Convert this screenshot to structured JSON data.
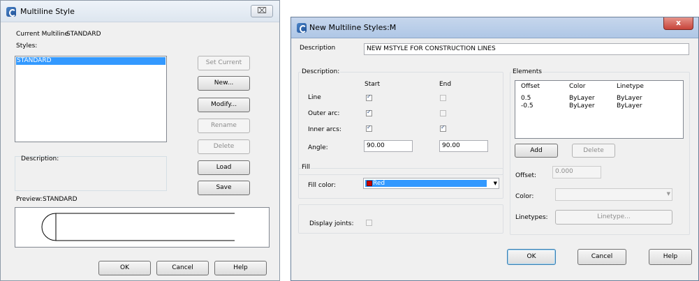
{
  "left_dialog": {
    "title": "Multiline Style",
    "close_glyph": "⌧",
    "current_label": "Current Multiline",
    "current_value": "STANDARD",
    "styles_label": "Styles:",
    "styles": [
      "STANDARD"
    ],
    "description_label": "Description:",
    "preview_label": "Preview:",
    "preview_value": "STANDARD",
    "buttons": {
      "set_current": "Set Current",
      "new": "New...",
      "modify": "Modify...",
      "rename": "Rename",
      "delete": "Delete",
      "load": "Load",
      "save": "Save",
      "ok": "OK",
      "cancel": "Cancel",
      "help": "Help"
    }
  },
  "right_dialog": {
    "title": "New Multiline Styles:M",
    "close_glyph": "x",
    "description_label": "Description",
    "description_value": "NEW MSTYLE FOR CONSTRUCTION LINES",
    "caps": {
      "group_label": "Description:",
      "col_start": "Start",
      "col_end": "End",
      "rows": [
        {
          "label": "Line",
          "start_checked": true,
          "end_checked": false
        },
        {
          "label": "Outer arc:",
          "start_checked": true,
          "end_checked": false
        },
        {
          "label": "Inner arcs:",
          "start_checked": true,
          "end_checked": true
        }
      ],
      "angle_label": "Angle:",
      "angle_start": "90.00",
      "angle_end": "90.00"
    },
    "fill": {
      "group_label": "Fill",
      "color_label": "Fill color:",
      "color_value": "Red",
      "color_hex": "#cc0000"
    },
    "display_joints_label": "Display joints:",
    "elements": {
      "group_label": "Elements",
      "headers": [
        "Offset",
        "Color",
        "Linetype"
      ],
      "rows": [
        [
          "0.5",
          "ByLayer",
          "ByLayer"
        ],
        [
          "-0.5",
          "ByLayer",
          "ByLayer"
        ]
      ],
      "add_label": "Add",
      "delete_label": "Delete",
      "offset_label": "Offset:",
      "offset_value": "0.000",
      "color_label": "Color:",
      "linetypes_label": "Linetypes:",
      "linetype_button": "Linetype..."
    },
    "buttons": {
      "ok": "OK",
      "cancel": "Cancel",
      "help": "Help"
    }
  }
}
